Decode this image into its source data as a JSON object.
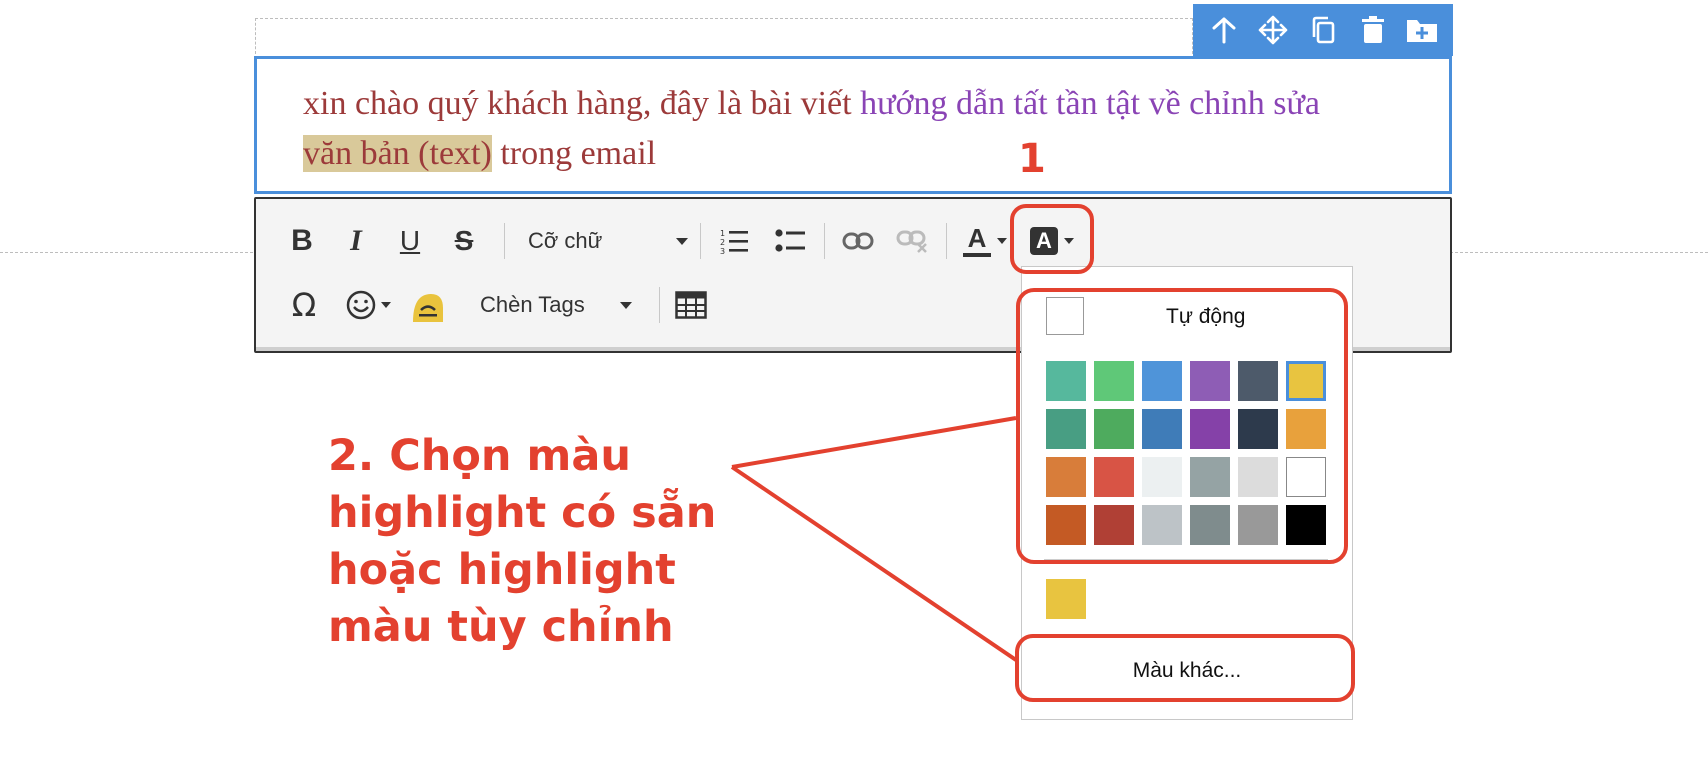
{
  "content": {
    "text_part1": "xin chào quý khách hàng, đây là bài viết ",
    "text_purple": "hướng dẫn tất tần tật về chỉnh sửa",
    "text_highlight": "văn bản (text)",
    "text_part2": " trong email"
  },
  "block_toolbar": {
    "icons": [
      "move-up-icon",
      "move-icon",
      "copy-icon",
      "delete-icon",
      "add-folder-icon"
    ],
    "background": "#4a8fdb"
  },
  "toolbar": {
    "bold": "B",
    "italic": "I",
    "underline": "U",
    "strikethrough": "S",
    "font_size_label": "Cỡ chữ",
    "text_color_letter": "A",
    "highlight_letter": "A",
    "special_char": "Ω",
    "insert_tags_label": "Chèn Tags"
  },
  "color_dropdown": {
    "auto_label": "Tự động",
    "more_colors_label": "Màu khác...",
    "selected_color": "#e8c440",
    "recent_color": "#e8c440",
    "palette": [
      [
        "#56b89d",
        "#5fc878",
        "#4f94d9",
        "#8e5db5",
        "#4d5a6a",
        "#e8c440"
      ],
      [
        "#489e83",
        "#4eab5e",
        "#3f7cb8",
        "#8541a8",
        "#2d3a4c",
        "#e8a13c"
      ],
      [
        "#d87d3a",
        "#d85445",
        "#ecf0f1",
        "#95a3a4",
        "#dcdcdc",
        "#ffffff"
      ],
      [
        "#c45a24",
        "#b04035",
        "#bdc3c7",
        "#7f8c8d",
        "#999999",
        "#000000"
      ]
    ]
  },
  "annotations": {
    "step1": "1",
    "step2": "2. Chọn màu highlight có sẵn hoặc highlight màu tùy chỉnh",
    "color": "#e3412f"
  }
}
